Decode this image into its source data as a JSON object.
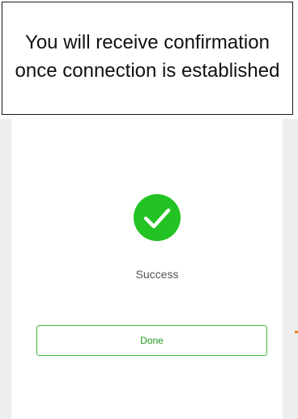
{
  "instruction": {
    "text": "You will receive confirmation once connection is established"
  },
  "status": {
    "icon": "check-circle-icon",
    "icon_color": "#22c322",
    "label": "Success"
  },
  "actions": {
    "done_label": "Done",
    "accent_color": "#3cb93c"
  }
}
